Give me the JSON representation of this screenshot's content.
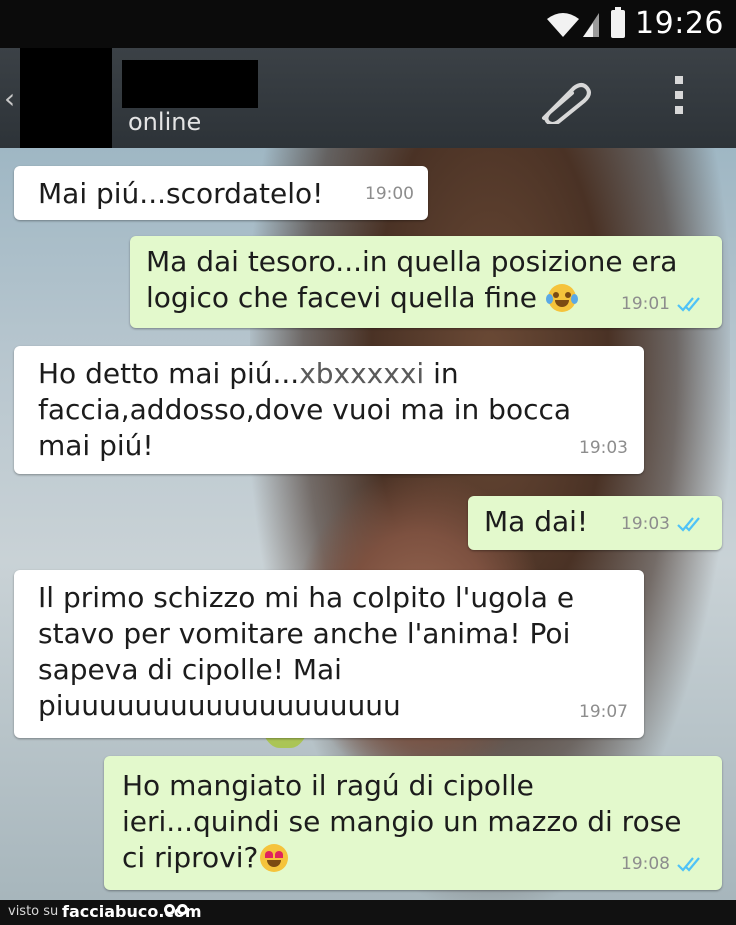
{
  "status_bar": {
    "time": "19:26"
  },
  "header": {
    "status": "online"
  },
  "messages": [
    {
      "text": "Mai piú...scordatelo!",
      "time": "19:00"
    },
    {
      "text": "Ma dai tesoro...in quella posizione era\nlogico che facevi quella fine",
      "time": "19:01",
      "emoji": "face-with-tears-of-joy"
    },
    {
      "text_before": "Ho detto mai piú...",
      "censored": "xbxxxxxi",
      "text_after": " in\nfaccia,addosso,dove vuoi ma in bocca\nmai piú!",
      "time": "19:03"
    },
    {
      "text": "Ma dai!",
      "time": "19:03"
    },
    {
      "text": "Il primo schizzo mi ha colpito l'ugola e\nstavo per vomitare anche l'anima! Poi\nsapeva di cipolle! Mai\npiuuuuuuuuuuuuuuuuuuu",
      "time": "19:07"
    },
    {
      "text": "Ho mangiato il ragú di cipolle\nieri...quindi se mangio un mazzo di rose\nci riprovi?",
      "time": "19:08",
      "emoji": "smiling-face-with-heart-eyes"
    }
  ],
  "footer": {
    "visto": "visto su",
    "brand": "facciabuco.com"
  },
  "colors": {
    "incoming_bubble": "#ffffff",
    "outgoing_bubble": "#e3f9cc",
    "tick_blue": "#4fc3f7",
    "header": "#353b40"
  }
}
